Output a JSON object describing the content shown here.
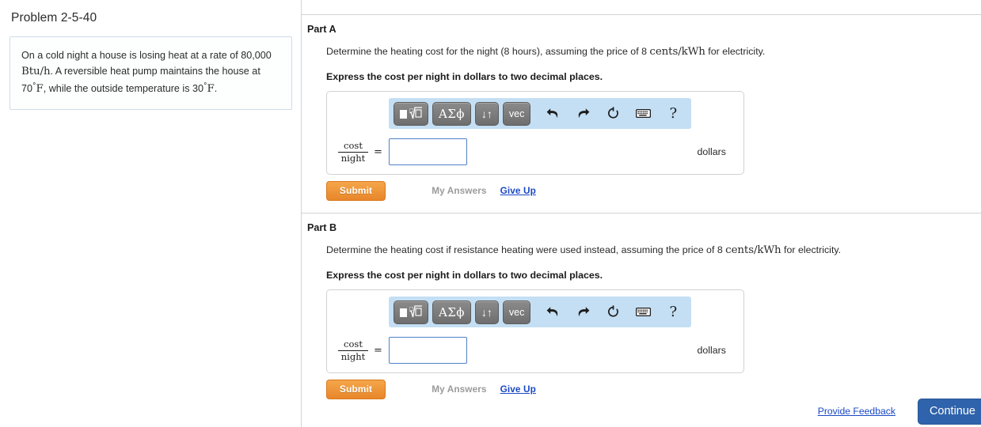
{
  "sidebar": {
    "problem_title": "Problem 2-5-40",
    "statement": {
      "line1_a": "On a cold night a house is losing heat at a rate of 80,000",
      "unit_btu": "Btu/h",
      "line2_a": ". A reversible heat pump maintains the house at",
      "temp_inside": "70",
      "deg_f": "°F",
      "line3_a": ", while the outside temperature is ",
      "temp_outside": "30",
      "deg_f_2": "°F",
      "period": "."
    }
  },
  "parts": [
    {
      "title": "Part A",
      "prompt_a": "Determine the heating cost for the night (8 hours), assuming the price of 8 ",
      "prompt_math": "cents/kWh",
      "prompt_b": " for electricity.",
      "instruction": "Express the cost per night in dollars to two decimal places.",
      "answer": {
        "fraction_numerator": "cost",
        "fraction_denominator": "night",
        "equals": "=",
        "value": "",
        "placeholder": "",
        "unit": "dollars"
      },
      "actions": {
        "submit": "Submit",
        "my_answers": "My Answers",
        "give_up": "Give Up"
      }
    },
    {
      "title": "Part B",
      "prompt_a": "Determine the heating cost if resistance heating were used instead, assuming the price of 8 ",
      "prompt_math": "cents/kWh",
      "prompt_b": " for electricity.",
      "instruction": "Express the cost per night in dollars to two decimal places.",
      "answer": {
        "fraction_numerator": "cost",
        "fraction_denominator": "night",
        "equals": "=",
        "value": "",
        "placeholder": "",
        "unit": "dollars"
      },
      "actions": {
        "submit": "Submit",
        "my_answers": "My Answers",
        "give_up": "Give Up"
      }
    }
  ],
  "mathbar": {
    "buttons": [
      {
        "name": "math-template",
        "label": ""
      },
      {
        "name": "greek-letters",
        "label": "ΑΣϕ"
      },
      {
        "name": "arrows",
        "label": "↓↑"
      },
      {
        "name": "vector",
        "label": "vec"
      }
    ],
    "icons": [
      {
        "name": "undo-icon",
        "glyph": "undo"
      },
      {
        "name": "redo-icon",
        "glyph": "redo"
      },
      {
        "name": "reset-icon",
        "glyph": "reset"
      },
      {
        "name": "keyboard-icon",
        "glyph": "keyboard"
      },
      {
        "name": "help-icon",
        "glyph": "?"
      }
    ]
  },
  "footer": {
    "provide_feedback": "Provide Feedback",
    "continue": "Continue"
  },
  "colors": {
    "mathbar_bg": "#c4dff4",
    "submit_orange": "#e8862a",
    "continue_blue": "#2f63ab",
    "link_blue": "#1a49c4",
    "muted_gray": "#9b9b9b",
    "input_border": "#4f81c7"
  }
}
